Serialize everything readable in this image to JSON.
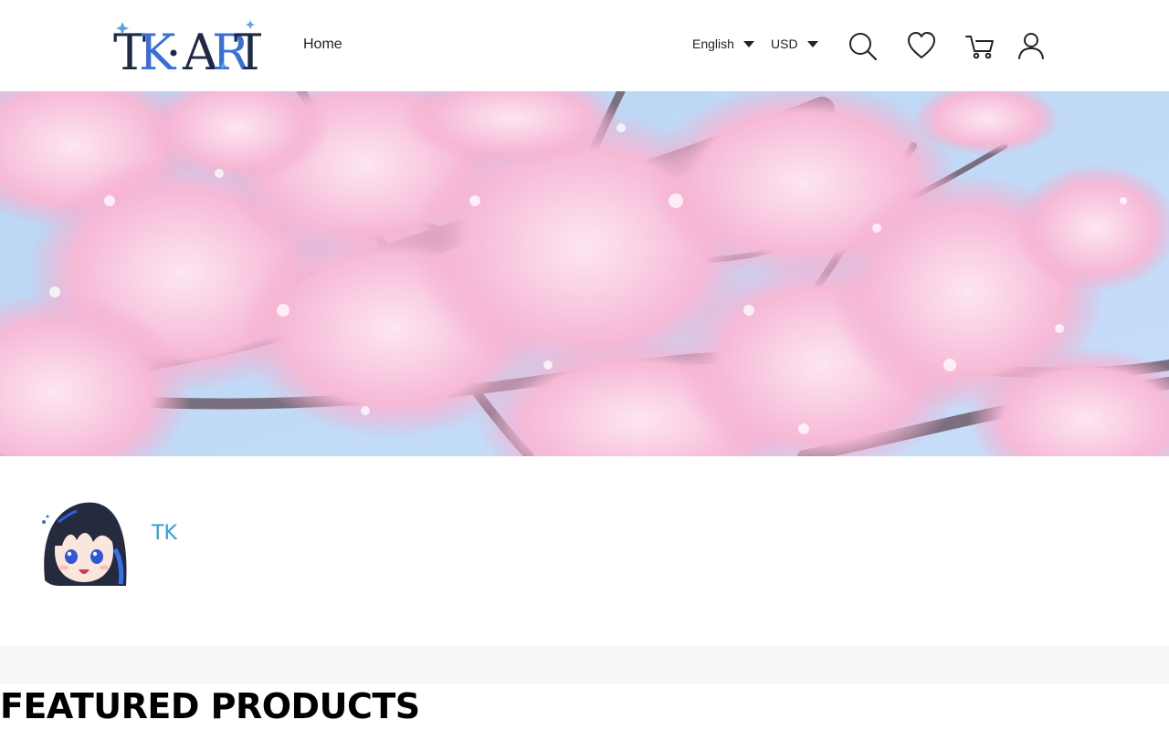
{
  "header": {
    "logo_text": "TK·ART",
    "nav_home": "Home",
    "language": "English",
    "currency": "USD",
    "icons": [
      "search-icon",
      "heart-icon",
      "cart-icon",
      "user-icon"
    ]
  },
  "banner": {
    "image": "cherry blossom branches against blue sky"
  },
  "profile": {
    "name": "TK",
    "name_color": "#2d9cdb"
  },
  "featured": {
    "title": "FEATURED PRODUCTS"
  }
}
